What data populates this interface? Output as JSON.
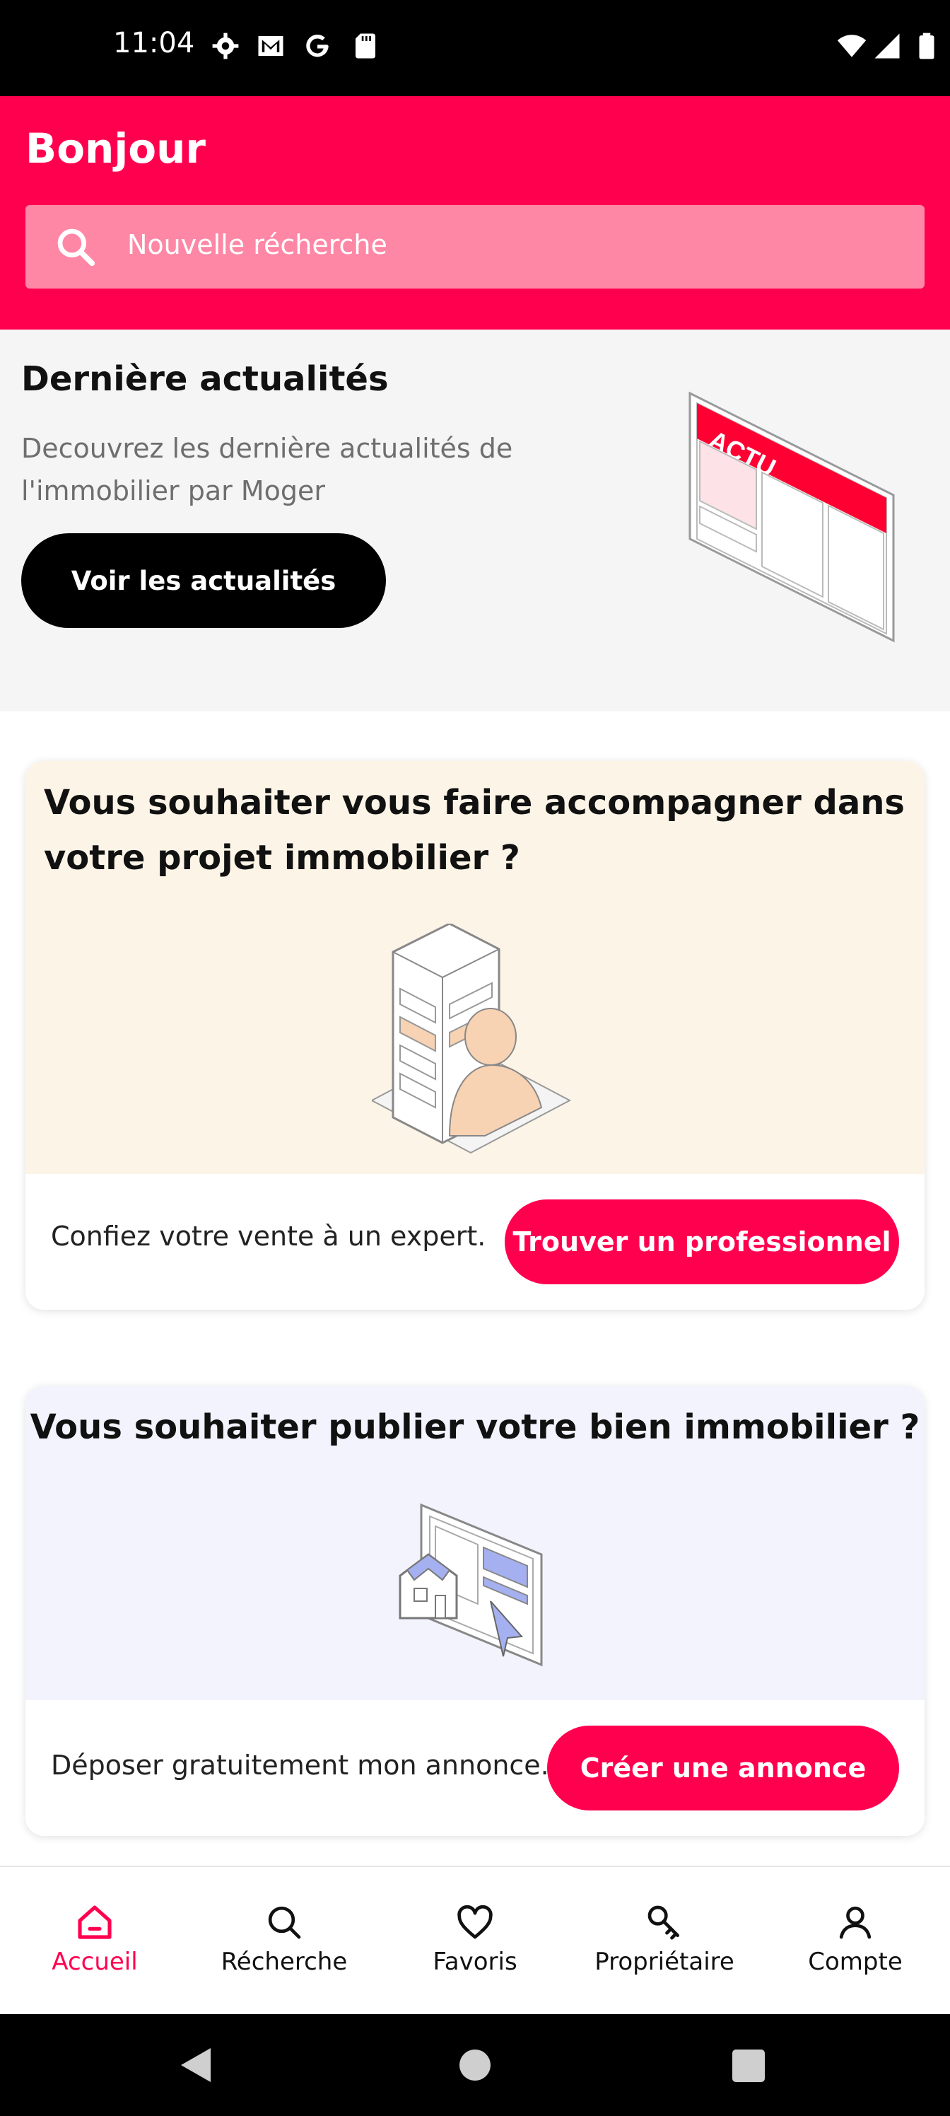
{
  "status_bar": {
    "time": "11:04",
    "left_icons": [
      "settings-icon",
      "gmail-icon",
      "google-icon",
      "sd-card-icon"
    ],
    "right_icons": [
      "wifi-icon",
      "signal-icon",
      "battery-icon"
    ]
  },
  "header": {
    "greeting": "Bonjour",
    "search_placeholder": "Nouvelle récherche",
    "background_color": "#ff004f"
  },
  "news": {
    "title": "Dernière actualités",
    "description": "Decouvrez les dernière actualités de l'immobilier par Moger",
    "button_label": "Voir les actualités",
    "illustration_label": "ACTU"
  },
  "pro_card": {
    "title": "Vous souhaiter vous faire accompagner dans votre projet immobilier ?",
    "text": "Confiez votre vente à un expert.",
    "button_label": "Trouver un professionnel"
  },
  "publish_card": {
    "title": "Vous souhaiter publier votre bien immobilier ?",
    "text": "Déposer gratuitement mon annonce.",
    "button_label": "Créer une annonce"
  },
  "bottom_nav": {
    "items": [
      {
        "label": "Accueil",
        "icon": "home-icon",
        "active": true
      },
      {
        "label": "Récherche",
        "icon": "search-icon",
        "active": false
      },
      {
        "label": "Favoris",
        "icon": "heart-icon",
        "active": false
      },
      {
        "label": "Propriétaire",
        "icon": "key-icon",
        "active": false
      },
      {
        "label": "Compte",
        "icon": "user-icon",
        "active": false
      }
    ]
  },
  "system_nav": {
    "buttons": [
      "back-icon",
      "home-circle-icon",
      "recents-icon"
    ]
  },
  "colors": {
    "accent": "#ff004f",
    "search_bg": "#ff87a6",
    "news_bg": "#f5f5f5",
    "pro_card_bg": "#fcf4e6",
    "publish_card_bg": "#f2f3fd"
  }
}
